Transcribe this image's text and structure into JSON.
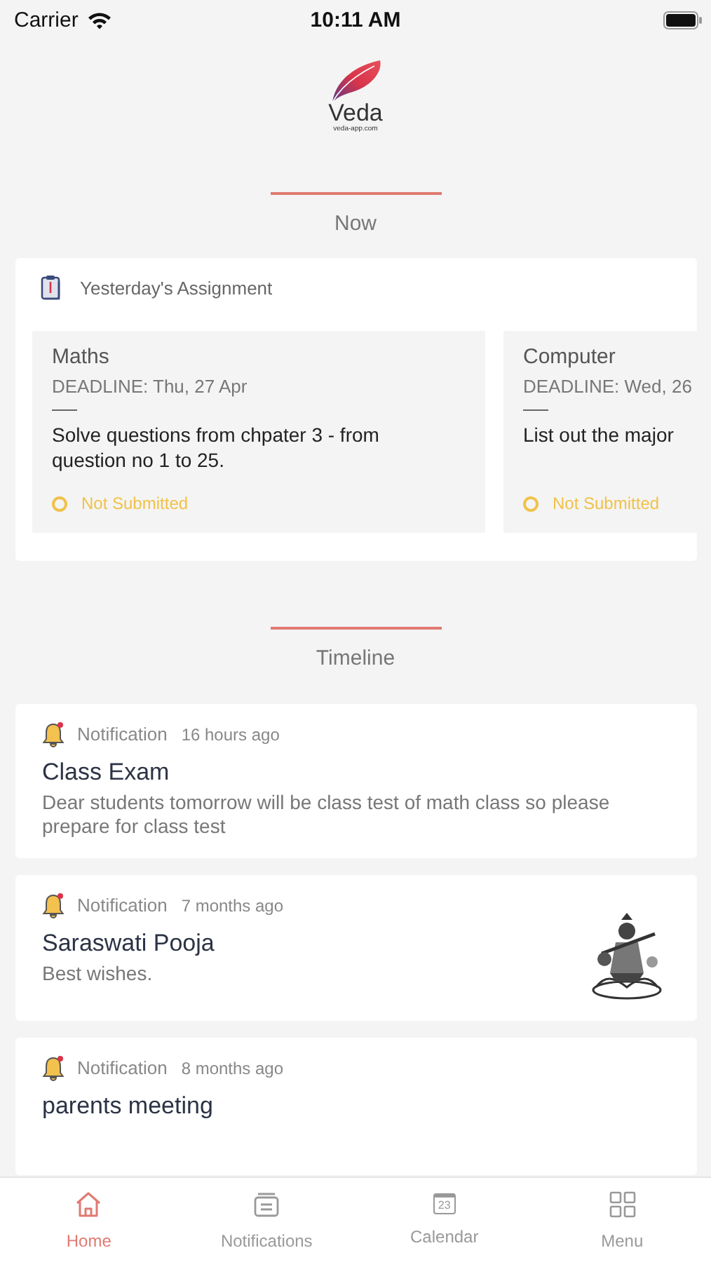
{
  "status_bar": {
    "carrier": "Carrier",
    "time": "10:11 AM"
  },
  "logo": {
    "name": "Veda",
    "url": "veda-app.com"
  },
  "now_section": {
    "title": "Now"
  },
  "assignments_card": {
    "title": "Yesterday's Assignment",
    "items": [
      {
        "subject": "Maths",
        "deadline": "DEADLINE: Thu, 27 Apr",
        "description": "Solve questions from chpater 3 - from question no 1 to 25.",
        "status": "Not Submitted",
        "cut": false
      },
      {
        "subject": "Computer",
        "deadline": "DEADLINE: Wed, 26",
        "description": "List out the major",
        "status": "Not Submitted",
        "cut": true
      }
    ]
  },
  "timeline_section": {
    "title": "Timeline"
  },
  "timeline": [
    {
      "type": "Notification",
      "time": "16 hours ago",
      "title": "Class Exam",
      "body": "Dear students tomorrow will be class test of math class so please prepare for class test",
      "has_picture": false
    },
    {
      "type": "Notification",
      "time": "7 months ago",
      "title": "Saraswati Pooja",
      "body": "Best wishes.",
      "has_picture": true
    },
    {
      "type": "Notification",
      "time": "8 months ago",
      "title": "parents meeting",
      "has_picture": false
    }
  ],
  "tab_bar": [
    {
      "kind": "home",
      "label": "Home",
      "selected": true
    },
    {
      "kind": "notifications",
      "label": "Notifications",
      "selected": false
    },
    {
      "kind": "calendar",
      "label": "Calendar",
      "day": "23",
      "selected": false
    },
    {
      "kind": "menu",
      "label": "Menu",
      "selected": false
    }
  ]
}
